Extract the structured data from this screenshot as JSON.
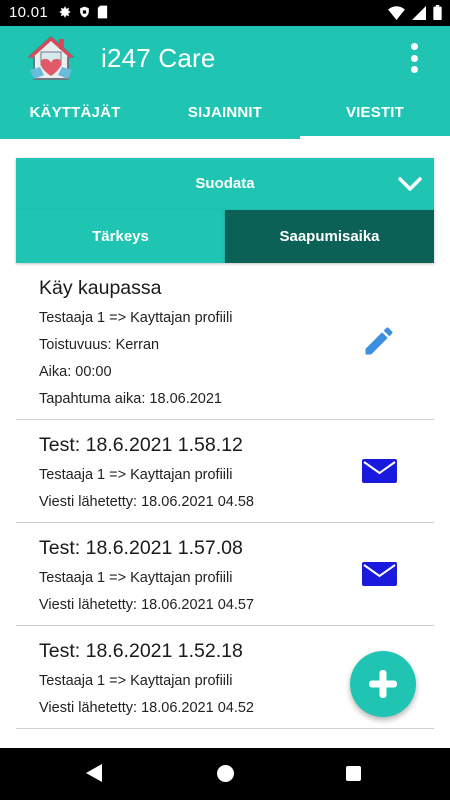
{
  "status_bar": {
    "time": "10.01",
    "left_icons": [
      "gear-icon",
      "shield-icon",
      "sd-card-icon"
    ],
    "right_icons": [
      "wifi-icon",
      "signal-icon",
      "battery-icon"
    ]
  },
  "app_bar": {
    "title": "i247 Care",
    "logo": "house-heart-logo",
    "menu_icon": "overflow-menu-icon",
    "tabs": [
      {
        "label": "KÄYTTÄJÄT",
        "active": false
      },
      {
        "label": "SIJAINNIT",
        "active": false
      },
      {
        "label": "VIESTIT",
        "active": true
      }
    ]
  },
  "filter": {
    "label": "Suodata",
    "icon": "chevron-down-icon"
  },
  "sort": {
    "priority_label": "Tärkeys",
    "arrival_label": "Saapumisaika",
    "selected": "Saapumisaika"
  },
  "messages": [
    {
      "title": "Käy kaupassa",
      "line1": "Testaaja 1  =>  Kayttajan profiili",
      "line2": "Toistuvuus: Kerran",
      "line3": "Aika: 00:00",
      "line4": "Tapahtuma aika: 18.06.2021",
      "icon": "pencil-icon"
    },
    {
      "title": "Test: 18.6.2021 1.58.12",
      "line1": "Testaaja 1  =>  Kayttajan profiili",
      "line2": "Viesti lähetetty: 18.06.2021 04.58",
      "icon": "envelope-icon"
    },
    {
      "title": "Test: 18.6.2021 1.57.08",
      "line1": "Testaaja 1  =>  Kayttajan profiili",
      "line2": "Viesti lähetetty: 18.06.2021 04.57",
      "icon": "envelope-icon"
    },
    {
      "title": "Test: 18.6.2021 1.52.18",
      "line1": "Testaaja 1  =>  Kayttajan profiili",
      "line2": "Viesti lähetetty: 18.06.2021 04.52",
      "icon": "envelope-icon"
    }
  ],
  "fab": {
    "icon": "plus-icon"
  },
  "colors": {
    "primary": "#1fc5b2",
    "selected_sort": "#0b6155",
    "pencil": "#3d8fe0",
    "envelope": "#1a1adf"
  },
  "nav_bar": {
    "back": "back-triangle-icon",
    "home": "home-circle-icon",
    "recents": "recents-square-icon"
  }
}
